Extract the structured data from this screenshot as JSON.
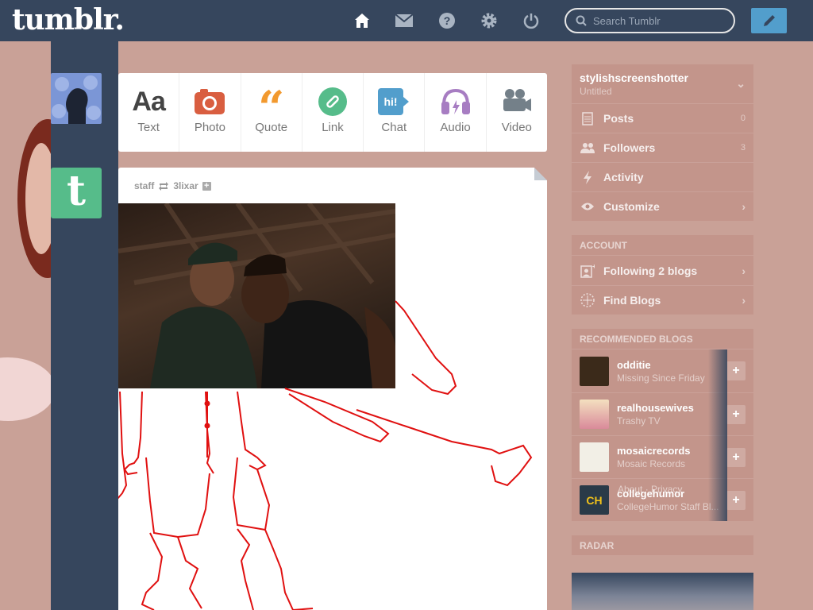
{
  "header": {
    "logo": "tumblr.",
    "search_placeholder": "Search Tumblr"
  },
  "post_types": [
    {
      "label": "Text",
      "icon": "text-icon"
    },
    {
      "label": "Photo",
      "icon": "camera-icon"
    },
    {
      "label": "Quote",
      "icon": "quote-icon"
    },
    {
      "label": "Link",
      "icon": "link-icon"
    },
    {
      "label": "Chat",
      "icon": "chat-icon"
    },
    {
      "label": "Audio",
      "icon": "headphones-icon"
    },
    {
      "label": "Video",
      "icon": "video-camera-icon"
    }
  ],
  "post": {
    "author": "staff",
    "reblogged_from": "3lixar"
  },
  "sidebar": {
    "blog_name": "stylishscreenshotter",
    "blog_title": "Untitled",
    "menu": [
      {
        "label": "Posts",
        "count": "0"
      },
      {
        "label": "Followers",
        "count": "3"
      },
      {
        "label": "Activity",
        "count": ""
      },
      {
        "label": "Customize",
        "count": ""
      }
    ],
    "account_heading": "ACCOUNT",
    "account_items": [
      {
        "label": "Following 2 blogs"
      },
      {
        "label": "Find Blogs"
      }
    ],
    "recommended_heading": "RECOMMENDED BLOGS",
    "recommended": [
      {
        "name": "odditie",
        "subtitle": "Missing Since Friday",
        "color": "#3b2a1a"
      },
      {
        "name": "realhousewives",
        "subtitle": "Trashy TV",
        "color": "#e8c8b8"
      },
      {
        "name": "mosaicrecords",
        "subtitle": "Mosaic Records",
        "color": "#f2efe6"
      },
      {
        "name": "collegehumor",
        "subtitle": "CollegeHumor Staff Bl...",
        "color": "#2a3a48"
      }
    ],
    "overlay_text": "About · Privacy",
    "radar_heading": "RADAR"
  },
  "colors": {
    "header_bg": "#36465d",
    "page_bg": "#c9a197",
    "accent": "#529ecc"
  }
}
